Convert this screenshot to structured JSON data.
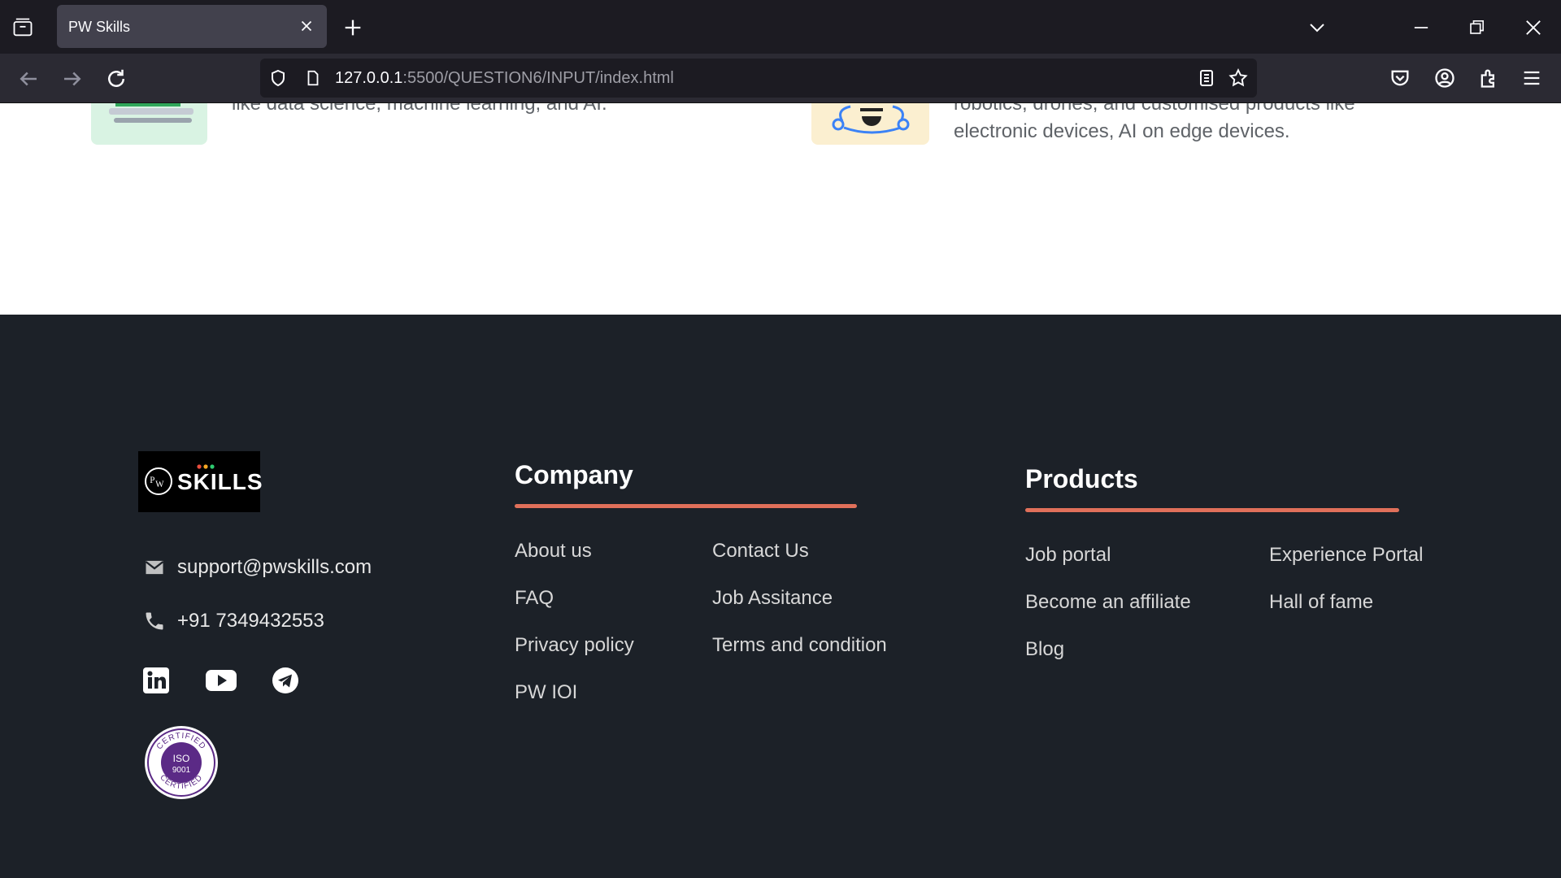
{
  "browser": {
    "tab_title": "PW Skills",
    "url_host": "127.0.0.1",
    "url_rest": ":5500/QUESTION6/INPUT/index.html"
  },
  "features": {
    "left_text": "like data science, machine learning, and AI.",
    "right_line1": "robotics, drones, and customised products like",
    "right_line2": "electronic devices, AI on edge devices."
  },
  "footer": {
    "logo_text": "SKILLS",
    "email": "support@pwskills.com",
    "phone": "+91 7349432553",
    "iso_top": "CERTIFIED",
    "iso_mid": "ISO",
    "iso_num": "9001",
    "iso_bottom": "CERTIFIED",
    "company": {
      "title": "Company",
      "col1": [
        "About us",
        "FAQ",
        "Privacy policy",
        "PW IOI"
      ],
      "col2": [
        "Contact Us",
        "Job Assitance",
        "Terms and condition"
      ]
    },
    "products": {
      "title": "Products",
      "col1": [
        "Job portal",
        "Become an affiliate",
        "Blog"
      ],
      "col2": [
        "Experience Portal",
        "Hall of fame"
      ]
    }
  },
  "colors": {
    "accent_bar": "#e0705a",
    "footer_bg": "#1c2128"
  }
}
